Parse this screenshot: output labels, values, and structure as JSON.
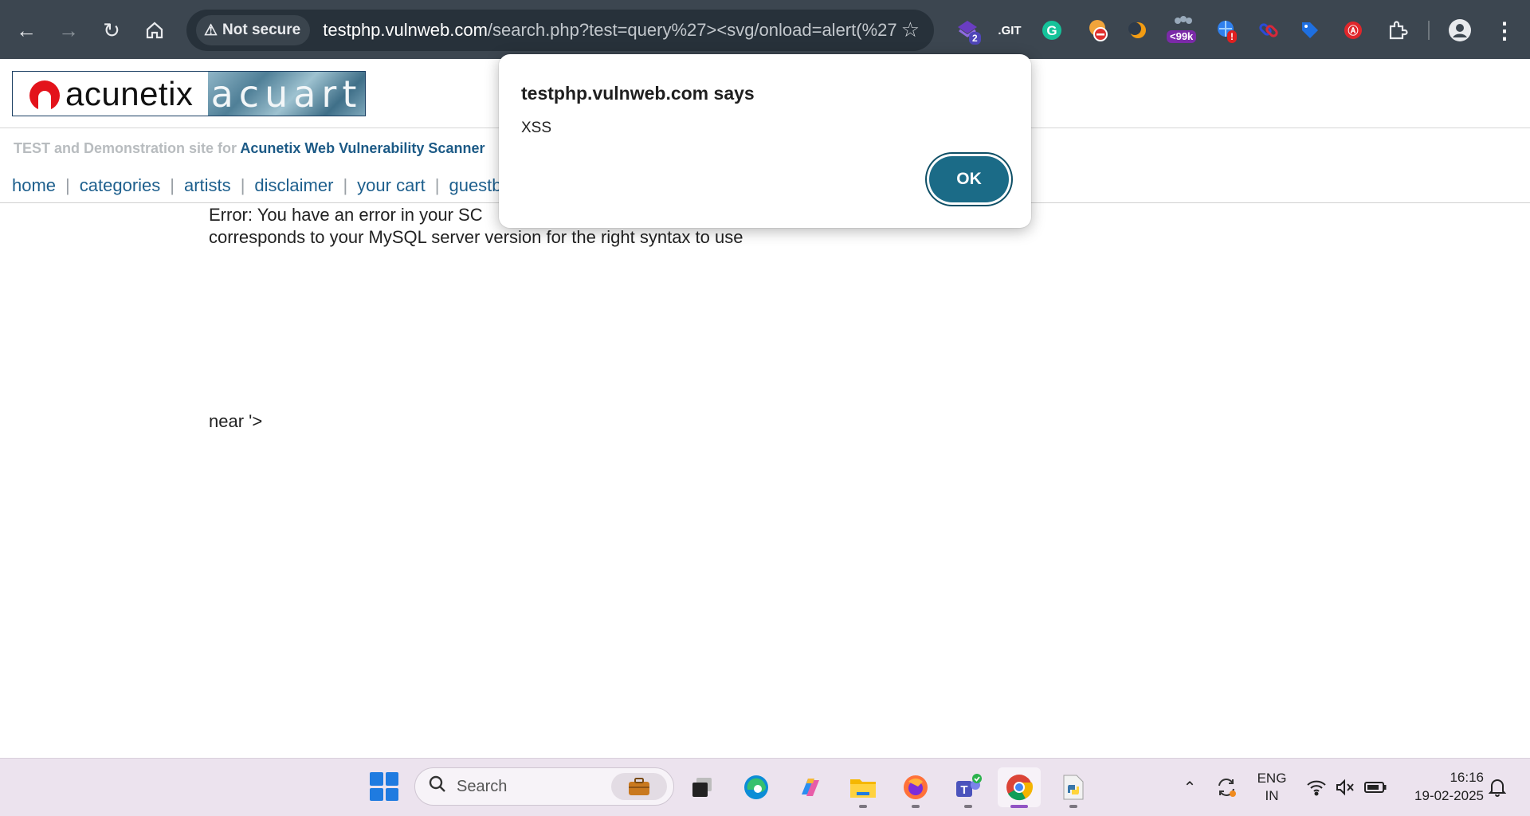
{
  "browser": {
    "security_label": "Not secure",
    "url_host": "testphp.vulnweb.com",
    "url_path": "/search.php?test=query%27><svg/onload=alert(%27...",
    "extension_badges": {
      "ext1_count": "2",
      "ext2_label": ".GIT",
      "ext_counter": "<99k",
      "ext_alert": "!"
    }
  },
  "site": {
    "logo_acunetix": "acunetix",
    "logo_acuart": "acuart",
    "tagline_prefix": "TEST and Demonstration site for ",
    "tagline_strong": "Acunetix Web Vulnerability Scanner",
    "nav": [
      "home",
      "categories",
      "artists",
      "disclaimer",
      "your cart",
      "guestboo"
    ],
    "error_line1": "Error: You have an error in your SC",
    "error_line2": "corresponds to your MySQL server version for the right syntax to use",
    "error_line3": "near '>"
  },
  "dialog": {
    "title": "testphp.vulnweb.com says",
    "message": "XSS",
    "ok_label": "OK"
  },
  "taskbar": {
    "search_placeholder": "Search",
    "lang_line1": "ENG",
    "lang_line2": "IN",
    "time": "16:16",
    "date": "19-02-2025",
    "apps": [
      "task-view",
      "edge",
      "copilot",
      "file-explorer",
      "firefox",
      "teams",
      "chrome",
      "python-file"
    ]
  },
  "colors": {
    "chrome_bg": "#3c4650",
    "link_blue": "#1d5f8d",
    "ok_button": "#1b6b87",
    "taskbar_bg": "#ece3ee"
  }
}
